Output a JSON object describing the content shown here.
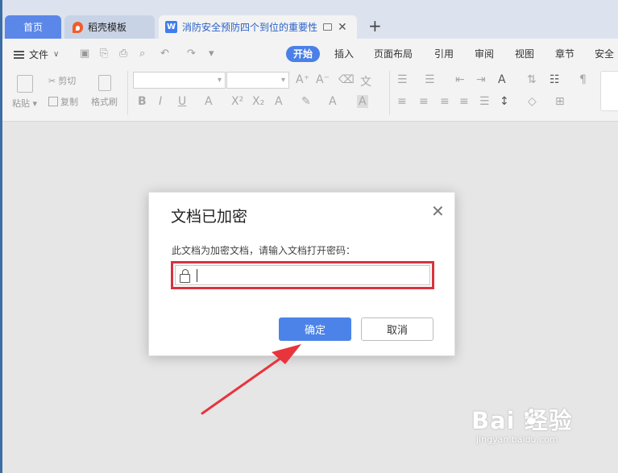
{
  "tabs": {
    "home": "首页",
    "templates": "稻壳模板",
    "document_icon": "W",
    "document": "消防安全预防四个到位的重要性"
  },
  "menu": {
    "file": "文件"
  },
  "ribbon_tabs": [
    "开始",
    "插入",
    "页面布局",
    "引用",
    "审阅",
    "视图",
    "章节",
    "安全"
  ],
  "ribbon_tools": {
    "paste": "粘贴",
    "cut": "剪切",
    "copy": "复制",
    "format_painter": "格式刷"
  },
  "dialog": {
    "title": "文档已加密",
    "prompt": "此文档为加密文档，请输入文档打开密码：",
    "password_value": "",
    "ok_button": "确定",
    "cancel_button": "取消"
  },
  "watermark": {
    "brand": "Bai 经验",
    "url": "jingyan.baidu.com"
  },
  "colors": {
    "accent": "#4c83e8",
    "highlight_border": "#d9333f",
    "arrow": "#e8343c"
  }
}
